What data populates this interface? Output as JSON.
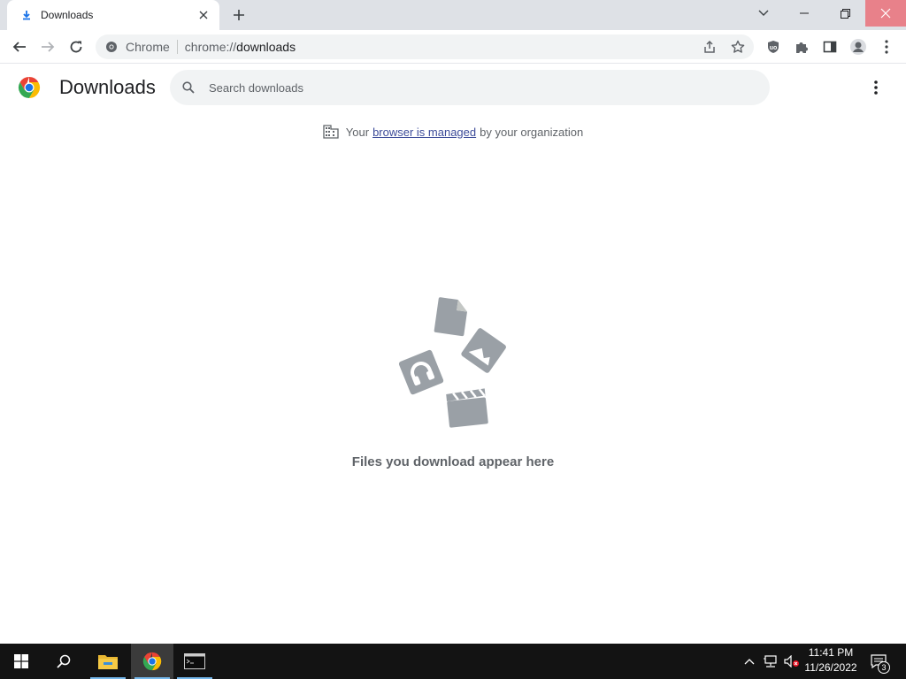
{
  "tab": {
    "title": "Downloads",
    "icon": "download-icon",
    "close_icon": "close-icon"
  },
  "window_controls": [
    "tab-search-icon",
    "minimize-icon",
    "restore-icon",
    "close-icon"
  ],
  "toolbar": {
    "nav_icons": [
      "back-arrow-icon",
      "forward-arrow-icon",
      "reload-icon"
    ],
    "omnibox": {
      "chip": "Chrome",
      "url_scheme": "chrome://",
      "url_path": "downloads"
    },
    "right_icons": [
      "share-icon",
      "bookmark-star-icon",
      "ublock-shield-icon",
      "extensions-puzzle-icon",
      "side-panel-icon",
      "profile-avatar-icon",
      "menu-kebab-icon"
    ]
  },
  "downloads": {
    "title": "Downloads",
    "search_placeholder": "Search downloads",
    "managed": {
      "prefix": "Your",
      "link": "browser is managed",
      "suffix": "by your organization"
    },
    "empty_text": "Files you download appear here"
  },
  "taskbar": {
    "apps": [
      "windows-start-icon",
      "search-icon",
      "file-explorer-icon",
      "chrome-icon",
      "terminal-icon"
    ],
    "active_app": "chrome-icon",
    "tray_icons": [
      "chevron-up-icon",
      "network-icon",
      "volume-muted-icon"
    ],
    "time": "11:41 PM",
    "date": "11/26/2022",
    "notification_count": "3"
  },
  "colors": {
    "accent": "#1a73e8",
    "close_hover": "#e8818a",
    "taskbar": "#131313",
    "tabstrip": "#dee1e6"
  }
}
